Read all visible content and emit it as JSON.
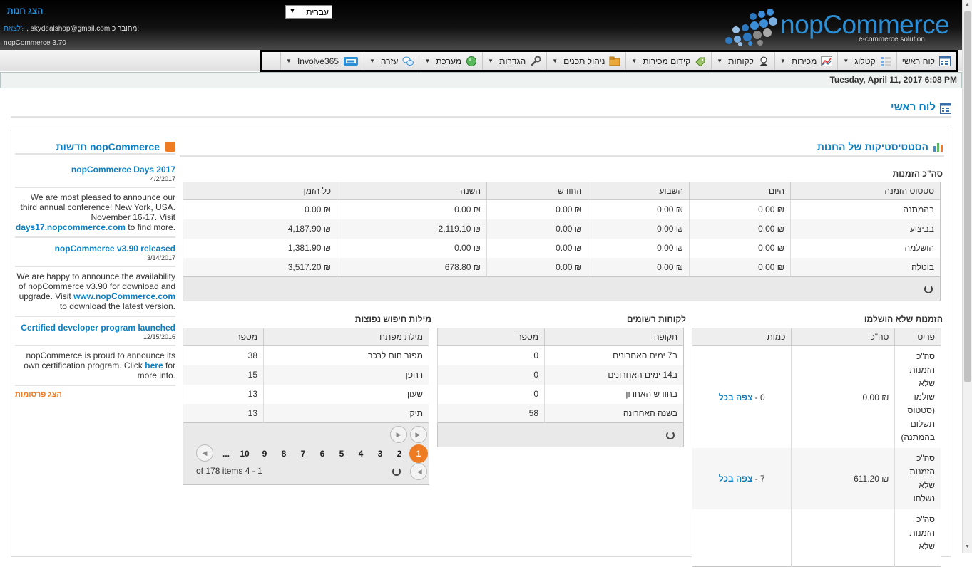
{
  "header": {
    "store_link": "הצג חנות",
    "language": "עברית",
    "user_prefix": "מחובר כ:",
    "user_email": "skydealshop@gmail.com",
    "logout": "לצאת?",
    "version": "nopCommerce 3.70",
    "logo_text": "nopCommerce",
    "logo_sub": "e-commerce solution"
  },
  "menu": [
    {
      "label": "לוח ראשי",
      "icon": "dashboard-icon",
      "dropdown": false
    },
    {
      "label": "קטלוג",
      "icon": "catalog-icon",
      "dropdown": true
    },
    {
      "label": "מכירות",
      "icon": "sales-chart-icon",
      "dropdown": true
    },
    {
      "label": "לקוחות",
      "icon": "customers-icon",
      "dropdown": true
    },
    {
      "label": "קידום מכירות",
      "icon": "promotions-icon",
      "dropdown": true
    },
    {
      "label": "ניהול תכנים",
      "icon": "content-icon",
      "dropdown": true
    },
    {
      "label": "הגדרות",
      "icon": "wrench-icon",
      "dropdown": true
    },
    {
      "label": "מערכת",
      "icon": "system-icon",
      "dropdown": true
    },
    {
      "label": "עזרה",
      "icon": "help-icon",
      "dropdown": true
    },
    {
      "label": "Involve365",
      "icon": "involve-icon",
      "dropdown": true
    }
  ],
  "date": "Tuesday, April 11, 2017 6:08 PM",
  "page_title": "לוח ראשי",
  "news": {
    "title": "חדשות nopCommerce",
    "items": [
      {
        "title": "nopCommerce Days 2017",
        "date": "4/2/2017",
        "body": "We are most pleased to announce our third annual conference! New York, USA. November 16-17. Visit",
        "link": "days17.nopcommerce.com",
        "tail": "to find more."
      },
      {
        "title": "nopCommerce v3.90 released",
        "date": "3/14/2017",
        "body": "We are happy to announce the availability of nopCommerce v3.90 for download and upgrade. Visit",
        "link": "www.nopCommerce.com",
        "tail": "to download the latest version."
      },
      {
        "title": "Certified developer program launched",
        "date": "12/15/2016",
        "body": "nopCommerce is proud to announce its own certification program. Click",
        "link": "here",
        "tail": "for more info."
      }
    ],
    "show_promotions": "הצג פרסומות"
  },
  "stats": {
    "title": "הסטטיסטיקות של החנות",
    "orders_total_title": "סה\"כ הזמנות",
    "orders_headers": [
      "סטטוס הזמנה",
      "היום",
      "השבוע",
      "החודש",
      "השנה",
      "כל הזמן"
    ],
    "orders_rows": [
      [
        "בהמתנה",
        "₪ 0.00",
        "₪ 0.00",
        "₪ 0.00",
        "₪ 0.00",
        "₪ 0.00"
      ],
      [
        "בביצוע",
        "₪ 0.00",
        "₪ 0.00",
        "₪ 0.00",
        "₪ 2,119.10",
        "₪ 4,187.90"
      ],
      [
        "הושלמה",
        "₪ 0.00",
        "₪ 0.00",
        "₪ 0.00",
        "₪ 0.00",
        "₪ 1,381.90"
      ],
      [
        "בוטלה",
        "₪ 0.00",
        "₪ 0.00",
        "₪ 0.00",
        "₪ 678.80",
        "₪ 3,517.20"
      ]
    ],
    "incomplete": {
      "title": "הזמנות שלא הושלמו",
      "headers": [
        "פריט",
        "סה\"כ",
        "כמות"
      ],
      "rows": [
        {
          "item": "סה\"כ הזמנות שלא שולמו (סטטוס תשלום בהמתנה)",
          "total": "₪ 0.00",
          "count": "0",
          "link": "צפה בכל"
        },
        {
          "item": "סה\"כ הזמנות שלא נשלחו",
          "total": "₪ 611.20",
          "count": "7",
          "link": "צפה בכל"
        },
        {
          "item": "סה\"כ הזמנות שלא",
          "total": "",
          "count": "",
          "link": ""
        }
      ]
    },
    "customers": {
      "title": "לקוחות רשומים",
      "headers": [
        "תקופה",
        "מספר"
      ],
      "rows": [
        [
          "ב7 ימים האחרונים",
          "0"
        ],
        [
          "ב14 ימים האחרונים",
          "0"
        ],
        [
          "בחודש האחרון",
          "0"
        ],
        [
          "בשנה האחרונה",
          "58"
        ]
      ]
    },
    "keywords": {
      "title": "מילות חיפוש נפוצות",
      "headers": [
        "מילת מפתח",
        "מספר"
      ],
      "rows": [
        [
          "מפזר חום לרכב",
          "38"
        ],
        [
          "רחפן",
          "15"
        ],
        [
          "שעון",
          "13"
        ],
        [
          "תיק",
          "13"
        ]
      ],
      "pages": [
        "1",
        "2",
        "3",
        "4",
        "5",
        "6",
        "7",
        "8",
        "9",
        "10",
        "..."
      ],
      "summary": "1 - 4 of 178 items"
    }
  }
}
